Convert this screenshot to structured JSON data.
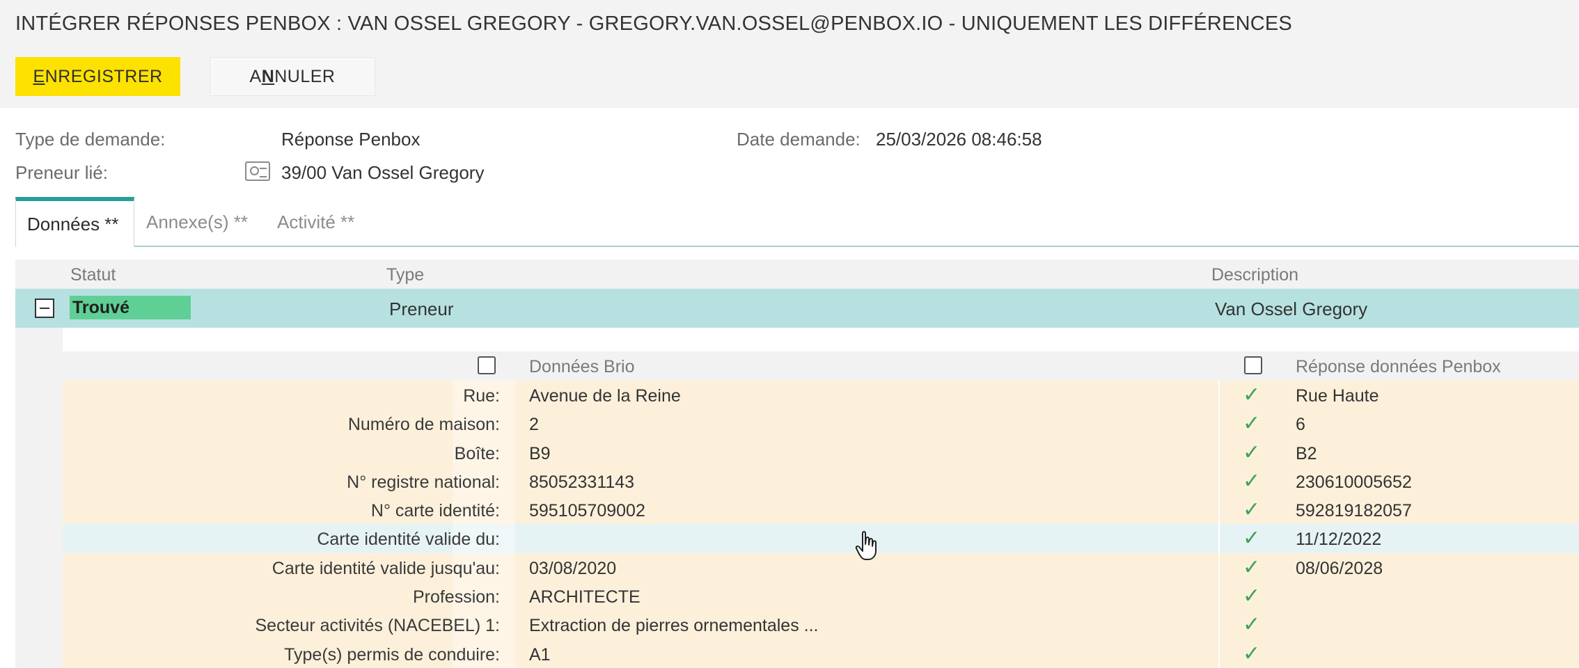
{
  "header": {
    "title": "INTÉGRER RÉPONSES PENBOX : VAN OSSEL GREGORY - GREGORY.VAN.OSSEL@PENBOX.IO - UNIQUEMENT LES DIFFÉRENCES",
    "save_first": "E",
    "save_rest": "NREGISTRER",
    "cancel_first": "A",
    "cancel_mid": "N",
    "cancel_rest": "NULER"
  },
  "meta": {
    "type_label": "Type de demande:",
    "type_value": "Réponse Penbox",
    "preneur_label": "Preneur lié:",
    "preneur_value": "39/00 Van Ossel Gregory",
    "date_label": "Date demande:",
    "date_value": "25/03/2026 08:46:58"
  },
  "tabs": [
    {
      "label": "Données **"
    },
    {
      "label": "Annexe(s) **"
    },
    {
      "label": "Activité **"
    }
  ],
  "grid": {
    "col_statut": "Statut",
    "col_type": "Type",
    "col_description": "Description",
    "row": {
      "status": "Trouvé",
      "type": "Preneur",
      "description": "Van Ossel Gregory"
    }
  },
  "detail": {
    "col_brio": "Données Brio",
    "col_penbox": "Réponse données Penbox",
    "check_glyph": "✓",
    "rows": [
      {
        "label": "Rue:",
        "brio": "Avenue de la Reine",
        "penbox": "Rue Haute"
      },
      {
        "label": "Numéro de maison:",
        "brio": "2",
        "penbox": "6"
      },
      {
        "label": "Boîte:",
        "brio": "B9",
        "penbox": "B2"
      },
      {
        "label": "N° registre national:",
        "brio": "85052331143",
        "penbox": "230610005652"
      },
      {
        "label": "N° carte identité:",
        "brio": "595105709002",
        "penbox": "592819182057"
      },
      {
        "label": "Carte identité valide du:",
        "brio": "",
        "penbox": "11/12/2022"
      },
      {
        "label": "Carte identité valide jusqu'au:",
        "brio": "03/08/2020",
        "penbox": "08/06/2028"
      },
      {
        "label": "Profession:",
        "brio": "ARCHITECTE",
        "penbox": ""
      },
      {
        "label": "Secteur activités (NACEBEL) 1:",
        "brio": "Extraction de pierres ornementales ...",
        "penbox": ""
      },
      {
        "label": "Type(s) permis de conduire:",
        "brio": "A1",
        "penbox": ""
      }
    ]
  },
  "colors": {
    "accent_yellow": "#fde200",
    "tab_accent": "#2a9d9a",
    "found_row": "#b7e1e1",
    "status_green": "#5fcf95",
    "detail_row": "#fdf0db",
    "check_green": "#3aa356"
  }
}
